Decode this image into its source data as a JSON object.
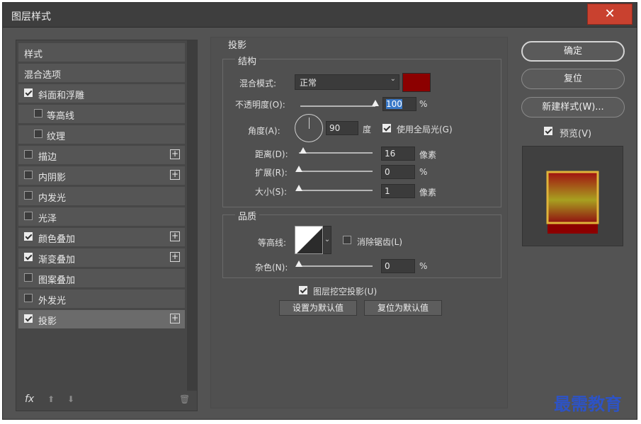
{
  "window": {
    "title": "图层样式",
    "close_glyph": "✕"
  },
  "sidebar": {
    "header": "样式",
    "items": [
      {
        "label": "混合选项",
        "checkbox": false,
        "checked": false,
        "plus": false
      },
      {
        "label": "斜面和浮雕",
        "checkbox": true,
        "checked": true,
        "plus": false
      },
      {
        "label": "等高线",
        "checkbox": true,
        "checked": false,
        "plus": false,
        "indent": true
      },
      {
        "label": "纹理",
        "checkbox": true,
        "checked": false,
        "plus": false,
        "indent": true
      },
      {
        "label": "描边",
        "checkbox": true,
        "checked": false,
        "plus": true
      },
      {
        "label": "内阴影",
        "checkbox": true,
        "checked": false,
        "plus": true
      },
      {
        "label": "内发光",
        "checkbox": true,
        "checked": false,
        "plus": false
      },
      {
        "label": "光泽",
        "checkbox": true,
        "checked": false,
        "plus": false
      },
      {
        "label": "颜色叠加",
        "checkbox": true,
        "checked": true,
        "plus": true
      },
      {
        "label": "渐变叠加",
        "checkbox": true,
        "checked": true,
        "plus": true
      },
      {
        "label": "图案叠加",
        "checkbox": true,
        "checked": false,
        "plus": false
      },
      {
        "label": "外发光",
        "checkbox": true,
        "checked": false,
        "plus": false
      },
      {
        "label": "投影",
        "checkbox": true,
        "checked": true,
        "plus": true,
        "selected": true
      }
    ],
    "plus_glyph": "+",
    "footer": {
      "fx": "fx",
      "up_glyph": "⬆",
      "down_glyph": "⬇",
      "trash_glyph": "🗑"
    }
  },
  "drop_shadow": {
    "section_title": "投影",
    "structure": {
      "title": "结构",
      "blend_mode_label": "混合模式:",
      "blend_mode_value": "正常",
      "shadow_color": "#8c0000",
      "opacity_label": "不透明度(O):",
      "opacity_value": "100",
      "opacity_unit": "%",
      "opacity_fraction": 1.0,
      "angle_label": "角度(A):",
      "angle_value": "90",
      "angle_unit": "度",
      "global_light_label": "使用全局光(G)",
      "global_light_checked": true,
      "distance_label": "距离(D):",
      "distance_value": "16",
      "distance_unit": "像素",
      "distance_fraction": 0.06,
      "spread_label": "扩展(R):",
      "spread_value": "0",
      "spread_unit": "%",
      "spread_fraction": 0.0,
      "size_label": "大小(S):",
      "size_value": "1",
      "size_unit": "像素",
      "size_fraction": 0.0
    },
    "quality": {
      "title": "品质",
      "contour_label": "等高线:",
      "anti_alias_label": "消除锯齿(L)",
      "anti_alias_checked": false,
      "noise_label": "杂色(N):",
      "noise_value": "0",
      "noise_unit": "%",
      "noise_fraction": 0.0
    },
    "knockout_label": "图层挖空投影(U)",
    "knockout_checked": true,
    "make_default": "设置为默认值",
    "reset_default": "复位为默认值"
  },
  "actions": {
    "ok": "确定",
    "reset": "复位",
    "new_style": "新建样式(W)...",
    "preview_label": "预览(V)",
    "preview_checked": true
  },
  "watermark": "最需教育",
  "colors": {
    "accent_select": "#3a79c8",
    "shadow": "#8c0000",
    "preview_gold": "#e0b43a"
  }
}
